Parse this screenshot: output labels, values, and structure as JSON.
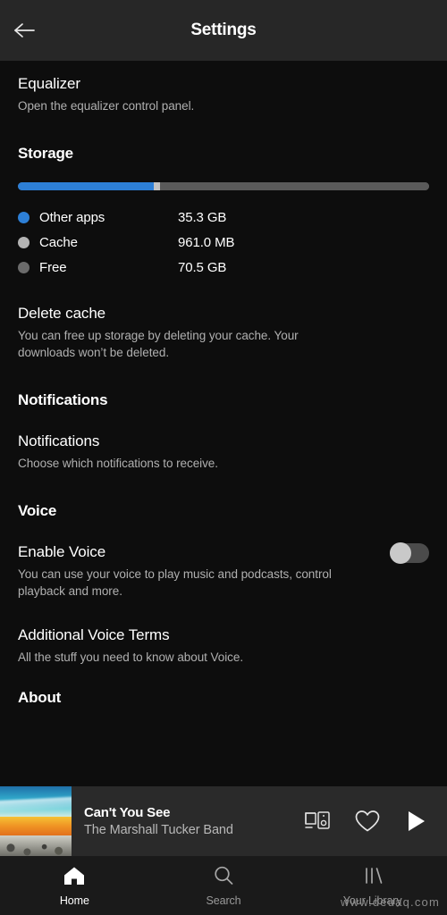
{
  "header": {
    "title": "Settings",
    "back_icon": "arrow-left-icon"
  },
  "settings": {
    "equalizer": {
      "title": "Equalizer",
      "subtitle": "Open the equalizer control panel."
    },
    "storage": {
      "heading": "Storage",
      "bar": {
        "other_apps_pct": 33.0,
        "cache_pct": 1.0,
        "free_pct": 66.0,
        "color_other": "#2d7fd6",
        "color_cache": "#c2c2c2",
        "color_free": "#5a5a5a"
      },
      "legend": [
        {
          "label": "Other apps",
          "value": "35.3 GB",
          "color": "#2d7fd6"
        },
        {
          "label": "Cache",
          "value": "961.0 MB",
          "color": "#b3b3b3"
        },
        {
          "label": "Free",
          "value": "70.5 GB",
          "color": "#6b6b6b"
        }
      ],
      "delete_cache": {
        "title": "Delete cache",
        "subtitle": "You can free up storage by deleting your cache. Your downloads won’t be deleted."
      }
    },
    "notifications": {
      "heading": "Notifications",
      "item": {
        "title": "Notifications",
        "subtitle": "Choose which notifications to receive."
      }
    },
    "voice": {
      "heading": "Voice",
      "enable_voice": {
        "title": "Enable Voice",
        "subtitle": "You can use your voice to play music and podcasts, control playback and more.",
        "toggle_state": "off"
      },
      "terms": {
        "title": "Additional Voice Terms",
        "subtitle": "All the stuff you need to know about Voice."
      }
    },
    "about": {
      "heading": "About"
    }
  },
  "player": {
    "track_title": "Can't You See",
    "artist": "The Marshall Tucker Band",
    "icons": {
      "connect": "connect-to-device-icon",
      "like": "heart-outline-icon",
      "play": "play-icon"
    }
  },
  "navbar": {
    "items": [
      {
        "label": "Home",
        "icon": "home-icon",
        "active": true
      },
      {
        "label": "Search",
        "icon": "search-icon",
        "active": false
      },
      {
        "label": "Your Library",
        "icon": "library-icon",
        "active": false
      }
    ]
  },
  "watermark": {
    "text": "www.deuaq.com"
  }
}
